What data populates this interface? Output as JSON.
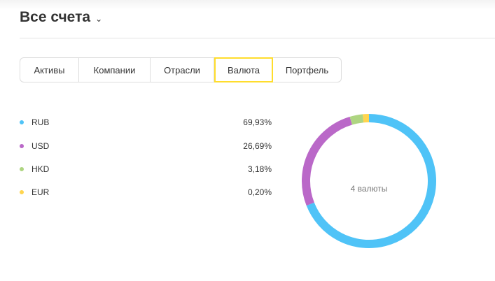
{
  "header": {
    "title": "Все счета"
  },
  "tabs": [
    {
      "label": "Активы"
    },
    {
      "label": "Компании"
    },
    {
      "label": "Отрасли"
    },
    {
      "label": "Валюта",
      "active": true
    },
    {
      "label": "Портфель"
    }
  ],
  "chart_data": {
    "type": "pie",
    "variant": "donut",
    "center_label": "4 валюты",
    "categories": [
      "RUB",
      "USD",
      "HKD",
      "EUR"
    ],
    "values": [
      69.93,
      26.69,
      3.18,
      0.2
    ],
    "value_labels": [
      "69,93%",
      "26,69%",
      "3,18%",
      "0,20%"
    ],
    "colors": [
      "#4fc3f7",
      "#ba68c8",
      "#aed581",
      "#ffd54f"
    ]
  }
}
